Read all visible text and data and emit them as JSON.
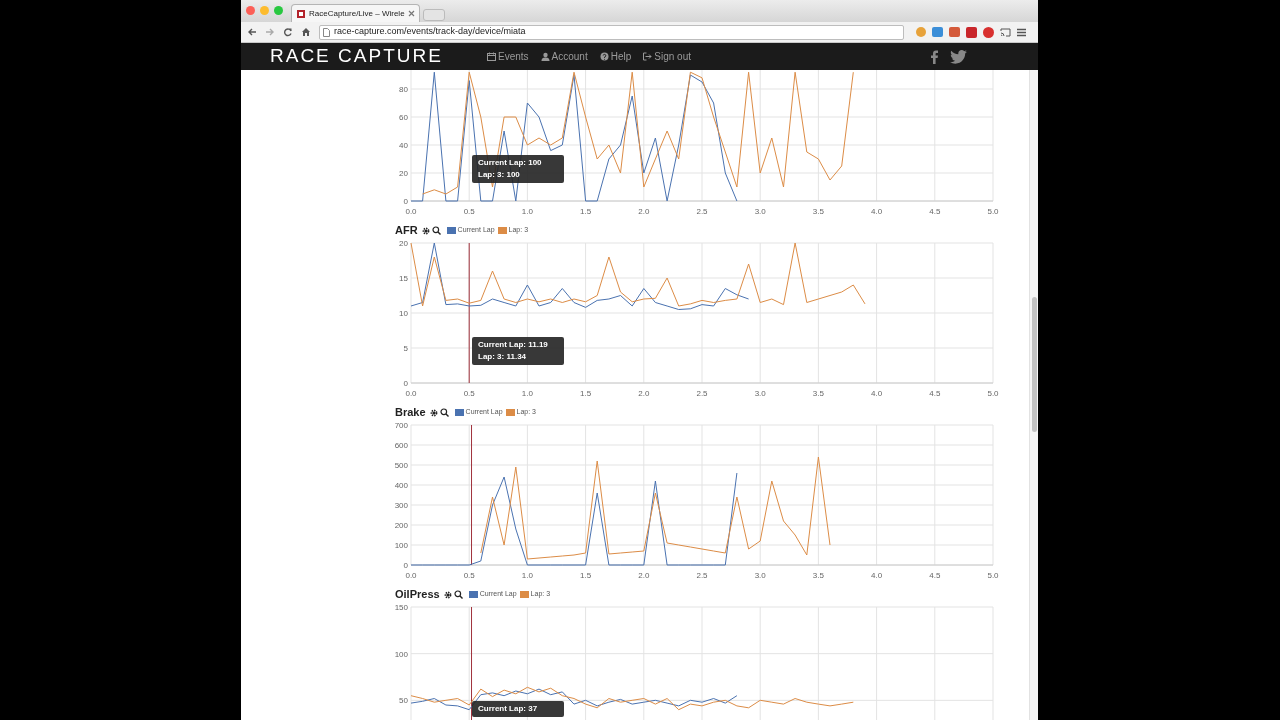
{
  "browser": {
    "tab": {
      "title": "RaceCapture/Live – Wirele"
    },
    "address": "race-capture.com/events/track-day/device/miata"
  },
  "navbar": {
    "logo": "RACE CAPTURE",
    "links": [
      {
        "label": "Events"
      },
      {
        "label": "Account"
      },
      {
        "label": "Help"
      },
      {
        "label": "Sign out"
      }
    ]
  },
  "charts": [
    {
      "tooltip": [
        "Current Lap: 100",
        "Lap: 3: 100"
      ],
      "chart_data": {
        "type": "line",
        "grid": true,
        "x": [
          0,
          0.1,
          0.2,
          0.3,
          0.4,
          0.5,
          0.6,
          0.7,
          0.8,
          0.9,
          1,
          1.1,
          1.2,
          1.3,
          1.4,
          1.5,
          1.6,
          1.7,
          1.8,
          1.9,
          2,
          2.1,
          2.2,
          2.3,
          2.4,
          2.5,
          2.6,
          2.7,
          2.8,
          2.9,
          3,
          3.1,
          3.2,
          3.3,
          3.4,
          3.5,
          3.6,
          3.7,
          3.8
        ],
        "xlim": [
          0,
          5
        ],
        "ylim": [
          0,
          100
        ],
        "xticks": [
          {
            "value": 0,
            "label": "0.0"
          },
          0.5,
          {
            "value": 1,
            "label": "1.0"
          },
          1.5,
          {
            "value": 2,
            "label": "2.0"
          },
          2.5,
          {
            "value": 3,
            "label": "3.0"
          },
          3.5,
          {
            "value": 4,
            "label": "4.0"
          },
          4.5,
          {
            "value": 5,
            "label": "5.0"
          }
        ],
        "yticks": [
          0,
          20,
          40,
          60,
          80
        ],
        "series": [
          {
            "color": "#4a72b0",
            "values": [
              0,
              0,
              92,
              0,
              0,
              86,
              0,
              0,
              50,
              0,
              70,
              60,
              36,
              40,
              90,
              0,
              0,
              30,
              40,
              75,
              20,
              45,
              0,
              40,
              90,
              85,
              70,
              20,
              0,
              null,
              null,
              null,
              null,
              null,
              null,
              null,
              null,
              null,
              null
            ]
          },
          {
            "color": "#dc8c46",
            "values": [
              null,
              5,
              8,
              5,
              10,
              92,
              60,
              10,
              60,
              60,
              40,
              45,
              40,
              45,
              92,
              60,
              30,
              40,
              20,
              92,
              10,
              30,
              50,
              30,
              92,
              88,
              60,
              35,
              10,
              92,
              20,
              45,
              10,
              92,
              35,
              30,
              15,
              25,
              92
            ]
          }
        ]
      }
    },
    {
      "tooltip": [
        "Current Lap: 11.19",
        "Lap: 3: 11.34"
      ],
      "chart_data": {
        "type": "line",
        "title": "AFR",
        "grid": true,
        "ref_lines": [
          {
            "axis": "x",
            "value": 0.5
          }
        ],
        "x": [
          0,
          0.1,
          0.2,
          0.3,
          0.4,
          0.5,
          0.6,
          0.7,
          0.8,
          0.9,
          1,
          1.1,
          1.2,
          1.3,
          1.4,
          1.5,
          1.6,
          1.7,
          1.8,
          1.9,
          2,
          2.1,
          2.2,
          2.3,
          2.4,
          2.5,
          2.6,
          2.7,
          2.8,
          2.9,
          3,
          3.1,
          3.2,
          3.3,
          3.4,
          3.5,
          3.6,
          3.7,
          3.8,
          3.9
        ],
        "xlim": [
          0,
          5
        ],
        "ylim": [
          0,
          20
        ],
        "xticks": [
          {
            "value": 0,
            "label": "0.0"
          },
          0.5,
          {
            "value": 1,
            "label": "1.0"
          },
          1.5,
          {
            "value": 2,
            "label": "2.0"
          },
          2.5,
          {
            "value": 3,
            "label": "3.0"
          },
          3.5,
          {
            "value": 4,
            "label": "4.0"
          },
          4.5,
          {
            "value": 5,
            "label": "5.0"
          }
        ],
        "yticks": [
          0,
          5,
          10,
          15,
          20
        ],
        "series": [
          {
            "name": "Current Lap",
            "color": "#4a72b0",
            "values": [
              11,
              11.5,
              20,
              11.2,
              11.3,
              11,
              11.1,
              12,
              11.5,
              11,
              14,
              11,
              11.5,
              13.5,
              11.5,
              10.8,
              11.8,
              12,
              12.5,
              11,
              13.5,
              11.5,
              11,
              10.5,
              10.6,
              11.2,
              11,
              13.5,
              12.6,
              12,
              null,
              null,
              null,
              null,
              null,
              null,
              null,
              null,
              null,
              null
            ]
          },
          {
            "name": "Lap: 3",
            "color": "#dc8c46",
            "values": [
              20,
              11,
              18,
              11.8,
              12,
              11.4,
              11.8,
              16,
              12,
              11.5,
              12,
              11.6,
              12,
              11.5,
              12,
              11.6,
              12.5,
              18,
              13,
              11.6,
              12,
              12.1,
              15,
              11,
              11.3,
              11.8,
              11.5,
              11.8,
              12,
              17,
              11.5,
              12,
              11.2,
              20,
              11.5,
              12,
              12.5,
              13,
              14,
              11.3
            ]
          }
        ]
      }
    },
    {
      "chart_data": {
        "type": "line",
        "title": "Brake",
        "grid": true,
        "ref_lines": [
          {
            "axis": "x",
            "value": 0.52
          }
        ],
        "x": [
          0,
          0.1,
          0.2,
          0.3,
          0.4,
          0.5,
          0.6,
          0.7,
          0.8,
          0.9,
          1,
          1.1,
          1.2,
          1.3,
          1.4,
          1.5,
          1.6,
          1.7,
          1.8,
          1.9,
          2,
          2.1,
          2.2,
          2.3,
          2.4,
          2.5,
          2.6,
          2.7,
          2.8,
          2.9,
          3,
          3.1,
          3.2,
          3.3,
          3.4,
          3.5,
          3.6
        ],
        "xlim": [
          0,
          5
        ],
        "ylim": [
          0,
          700
        ],
        "xticks": [
          {
            "value": 0,
            "label": "0.0"
          },
          0.5,
          {
            "value": 1,
            "label": "1.0"
          },
          1.5,
          {
            "value": 2,
            "label": "2.0"
          },
          2.5,
          {
            "value": 3,
            "label": "3.0"
          },
          3.5,
          {
            "value": 4,
            "label": "4.0"
          },
          4.5,
          {
            "value": 5,
            "label": "5.0"
          }
        ],
        "yticks": [
          0,
          100,
          200,
          300,
          400,
          500,
          600,
          700
        ],
        "series": [
          {
            "name": "Current Lap",
            "color": "#4a72b0",
            "values": [
              0,
              0,
              0,
              0,
              0,
              0,
              20,
              300,
              440,
              180,
              0,
              0,
              0,
              0,
              0,
              0,
              360,
              0,
              0,
              0,
              0,
              420,
              0,
              0,
              0,
              0,
              0,
              0,
              460,
              null,
              null,
              null,
              null,
              null,
              null,
              null,
              null
            ]
          },
          {
            "name": "Lap: 3",
            "color": "#dc8c46",
            "values": [
              null,
              null,
              null,
              null,
              null,
              null,
              60,
              340,
              100,
              490,
              30,
              35,
              40,
              45,
              50,
              60,
              520,
              55,
              60,
              65,
              70,
              360,
              110,
              100,
              90,
              80,
              70,
              60,
              340,
              80,
              120,
              420,
              220,
              150,
              50,
              540,
              100
            ]
          }
        ]
      }
    },
    {
      "tooltip": [
        "Current Lap: 37"
      ],
      "chart_data": {
        "type": "line",
        "title": "OilPress",
        "grid": true,
        "ref_lines": [
          {
            "axis": "x",
            "value": 0.52
          }
        ],
        "x": [
          0,
          0.1,
          0.2,
          0.3,
          0.4,
          0.5,
          0.6,
          0.7,
          0.8,
          0.9,
          1,
          1.1,
          1.2,
          1.3,
          1.4,
          1.5,
          1.6,
          1.7,
          1.8,
          1.9,
          2,
          2.1,
          2.2,
          2.3,
          2.4,
          2.5,
          2.6,
          2.7,
          2.8,
          2.9,
          3,
          3.1,
          3.2,
          3.3,
          3.4,
          3.5,
          3.6,
          3.7,
          3.8
        ],
        "xlim": [
          0,
          5
        ],
        "ylim": [
          0,
          150
        ],
        "yticks": [
          50,
          100,
          150
        ],
        "series": [
          {
            "name": "Current Lap",
            "color": "#4a72b0",
            "values": [
              47,
              49,
              52,
              45,
              44,
              40,
              56,
              58,
              55,
              60,
              57,
              62,
              56,
              59,
              46,
              50,
              44,
              48,
              51,
              46,
              48,
              50,
              47,
              44,
              50,
              48,
              52,
              47,
              55,
              null,
              null,
              null,
              null,
              null,
              null,
              null,
              null,
              null,
              null
            ]
          },
          {
            "name": "Lap: 3",
            "color": "#dc8c46",
            "values": [
              55,
              52,
              48,
              50,
              52,
              45,
              62,
              54,
              61,
              57,
              64,
              59,
              63,
              55,
              52,
              46,
              42,
              52,
              48,
              50,
              52,
              46,
              52,
              40,
              46,
              44,
              48,
              50,
              44,
              42,
              50,
              48,
              46,
              52,
              48,
              46,
              44,
              46,
              48
            ]
          }
        ]
      }
    }
  ]
}
